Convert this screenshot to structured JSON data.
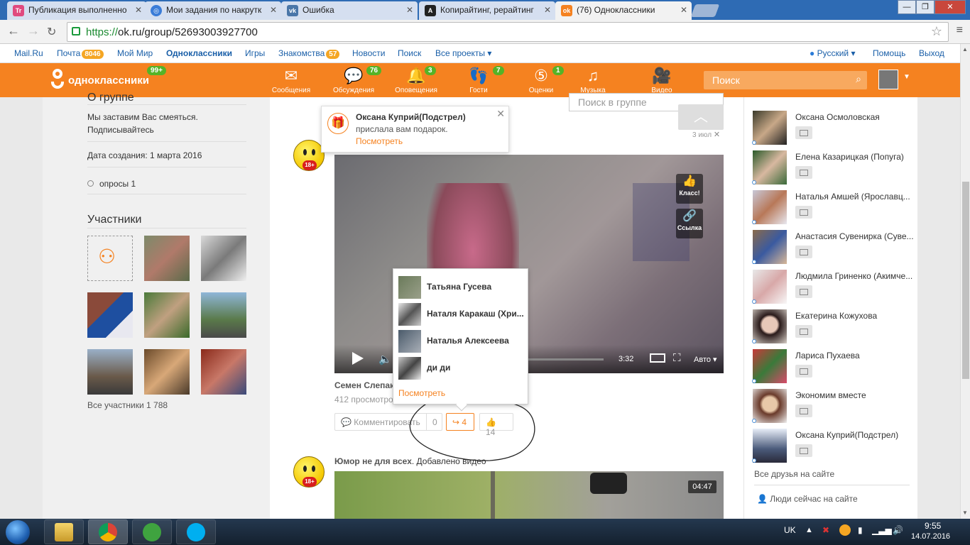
{
  "browser": {
    "tabs": [
      {
        "label": "Публикация выполненно",
        "icon": "text-icon",
        "color": "#e04a7f"
      },
      {
        "label": "Мои задания по накрутк",
        "icon": "circle-icon",
        "color": "#3b7dd8"
      },
      {
        "label": "Ошибка",
        "icon": "vk-icon",
        "color": "#4a76a8"
      },
      {
        "label": "Копирайтинг, рерайтинг",
        "icon": "a-icon",
        "color": "#222222"
      },
      {
        "label": "(76) Одноклассники",
        "icon": "ok-icon",
        "color": "#f58220"
      }
    ],
    "url_scheme": "https://",
    "url_rest": "ok.ru/group/52693003927700"
  },
  "portal": {
    "left": [
      {
        "label": "Mail.Ru"
      },
      {
        "label": "Почта",
        "badge": "8046"
      },
      {
        "label": "Мой Мир"
      },
      {
        "label": "Одноклассники"
      },
      {
        "label": "Игры"
      },
      {
        "label": "Знакомства",
        "badge": "57"
      },
      {
        "label": "Новости"
      },
      {
        "label": "Поиск"
      },
      {
        "label": "Все проекты ▾"
      }
    ],
    "lang": "Русский ▾",
    "help": "Помощь",
    "logout": "Выход"
  },
  "ok": {
    "logo_text": "одноклассники",
    "logo_badge": "99+",
    "nav": [
      {
        "label": "Сообщения",
        "icon": "envelope-icon",
        "badge": ""
      },
      {
        "label": "Обсуждения",
        "icon": "chat-bubbles-icon",
        "badge": "76"
      },
      {
        "label": "Оповещения",
        "icon": "bell-icon",
        "badge": "3"
      },
      {
        "label": "Гости",
        "icon": "footprints-icon",
        "badge": "7"
      },
      {
        "label": "Оценки",
        "icon": "rating-icon",
        "badge": "1"
      },
      {
        "label": "Музыка",
        "icon": "music-note-icon",
        "badge": ""
      },
      {
        "label": "Видео",
        "icon": "video-camera-icon",
        "badge": ""
      }
    ],
    "search_placeholder": "Поиск"
  },
  "left": {
    "about_title": "О группе",
    "about_text1": "Мы заставим Вас смеяться.",
    "about_text2": "Подписывайтесь",
    "created": "Дата создания: 1 марта 2016",
    "polls": "опросы 1",
    "members_title": "Участники",
    "all_members": "Все участники 1 788"
  },
  "feed": {
    "group_search_placeholder": "Поиск в группе",
    "date": "3 июл",
    "video1_duration": "3:32",
    "video_quality": "Авто ▾",
    "klass_label": "Класс!",
    "link_label": "Ссылка",
    "post1_author": "Семен Слепак",
    "post1_views": "412 просмотров",
    "comment_label": "Комментировать",
    "comment_count": "0",
    "reshare_count": "4",
    "like_count": "14",
    "post2_author": "Юмор не для всех",
    "post2_action": ". Добавлено видео",
    "video2_duration": "04:47"
  },
  "notification": {
    "name": "Оксана Куприй(Подстрел)",
    "text": "прислала вам подарок.",
    "link": "Посмотреть"
  },
  "share_popup": {
    "users": [
      "Татьяна Гусева",
      "Наталя Каракаш (Хри...",
      "Наталья Алексеева",
      "ди ди"
    ],
    "more": "Посмотреть"
  },
  "friends": {
    "list": [
      "Оксана Осмоловская",
      "Елена Казарицкая (Попуга)",
      "Наталья Амшей (Ярославц...",
      "Анастасия Сувенирка (Суве...",
      "Людмила Гриненко (Акимче...",
      "Екатерина Кожухова",
      "Лариса Пухаева",
      "Экономим вместе",
      "Оксана Куприй(Подстрел)"
    ],
    "all_on_site": "Все друзья на сайте",
    "people_now": "Люди сейчас на сайте"
  },
  "taskbar": {
    "lang": "UK",
    "time": "9:55",
    "date": "14.07.2016"
  }
}
